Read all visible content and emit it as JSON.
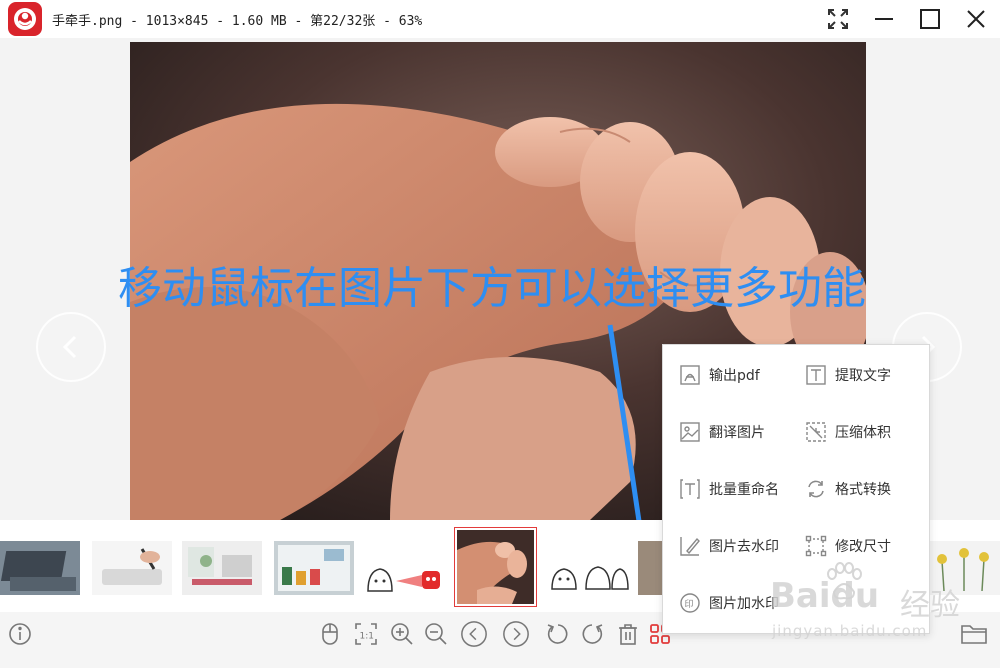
{
  "window": {
    "title": "手牵手.png - 1013×845 - 1.60 MB - 第22/32张 - 63%",
    "controls": [
      "fullscreen-icon",
      "minimize-icon",
      "maximize-icon",
      "close-icon"
    ]
  },
  "viewer": {
    "caption": "移动鼠标在图片下方可以选择更多功能",
    "prev_icon": "chevron-left-icon",
    "next_icon": "chevron-right-icon"
  },
  "thumbnails": {
    "active_index": 5,
    "items": [
      {
        "subject": "laptop"
      },
      {
        "subject": "drawing-tablet"
      },
      {
        "subject": "desk"
      },
      {
        "subject": "fridge"
      },
      {
        "subject": "sticker-ghost"
      },
      {
        "subject": "hands"
      },
      {
        "subject": "sticker-cats"
      },
      {
        "subject": "partial"
      },
      {
        "subject": "flowers"
      }
    ]
  },
  "menu": {
    "items": [
      {
        "label": "输出pdf",
        "icon": "pdf-icon"
      },
      {
        "label": "提取文字",
        "icon": "text-extract-icon"
      },
      {
        "label": "翻译图片",
        "icon": "image-translate-icon"
      },
      {
        "label": "压缩体积",
        "icon": "compress-icon"
      },
      {
        "label": "批量重命名",
        "icon": "rename-icon"
      },
      {
        "label": "格式转换",
        "icon": "convert-icon"
      },
      {
        "label": "图片去水印",
        "icon": "remove-watermark-icon"
      },
      {
        "label": "修改尺寸",
        "icon": "resize-icon"
      },
      {
        "label": "图片加水印",
        "icon": "add-watermark-icon"
      }
    ]
  },
  "toolbar": {
    "left": [
      "info-icon"
    ],
    "center": [
      "mouse-icon",
      "actual-size-icon",
      "zoom-in-icon",
      "zoom-out-icon",
      "previous-icon",
      "next-icon",
      "rotate-left-icon",
      "rotate-right-icon",
      "delete-icon",
      "more-functions-icon"
    ],
    "right": [
      "folder-icon"
    ]
  },
  "watermark": {
    "brand": "Baidu",
    "cn": "经验",
    "url": "jingyan.baidu.com"
  },
  "colors": {
    "accent_red": "#e23b3b",
    "caption_blue": "#2e8ef2",
    "logo_red": "#d9242b"
  }
}
